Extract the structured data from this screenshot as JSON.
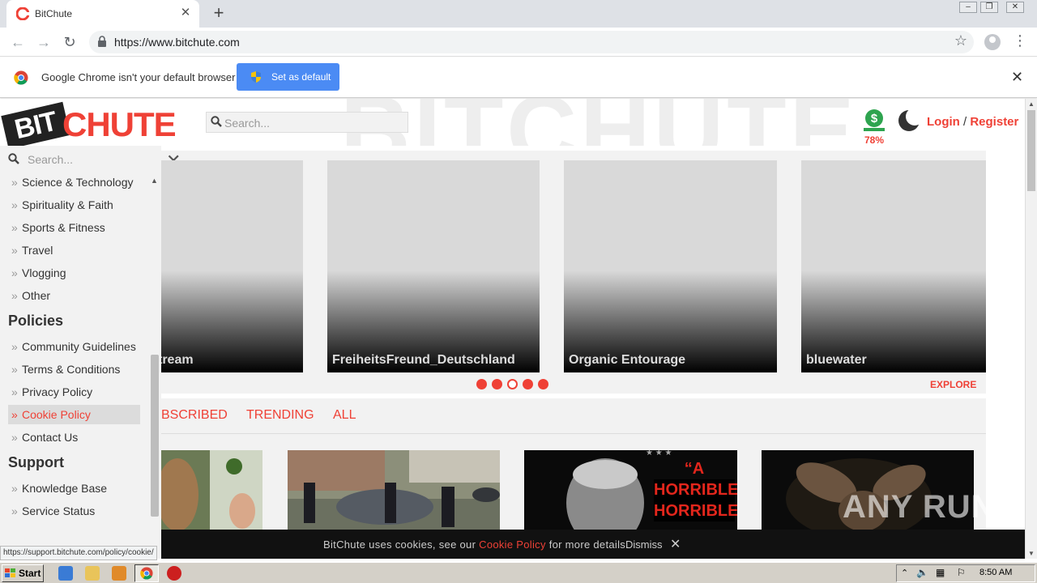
{
  "browser": {
    "tab_title": "BitChute",
    "url": "https://www.bitchute.com",
    "infobar_message": "Google Chrome isn't your default browser",
    "set_default_label": "Set as default"
  },
  "site": {
    "search_placeholder": "Search...",
    "money_percent": "78%",
    "login_label": "Login",
    "separator": "/",
    "register_label": "Register",
    "sidebar": {
      "search_placeholder": "Search...",
      "categories": [
        "Science & Technology",
        "Spirituality & Faith",
        "Sports & Fitness",
        "Travel",
        "Vlogging",
        "Other"
      ],
      "policies_heading": "Policies",
      "policies": [
        "Community Guidelines",
        "Terms & Conditions",
        "Privacy Policy",
        "Cookie Policy",
        "Contact Us"
      ],
      "support_heading": "Support",
      "support": [
        "Knowledge Base",
        "Service Status"
      ]
    },
    "carousel": {
      "channels": [
        "tream",
        "FreiheitsFreund_Deutschland",
        "Organic Entourage",
        "bluewater"
      ],
      "explore_label": "EXPLORE"
    },
    "feed_tabs": [
      "BSCRIBED",
      "TRENDING",
      "ALL"
    ],
    "thumbnail_overlay_text": [
      "“A",
      "HORRIBLE",
      "HORRIBLE"
    ],
    "cookie_bar": {
      "text_before": "BitChute uses cookies, see our ",
      "link": "Cookie Policy",
      "text_after": " for more details.",
      "dismiss": "Dismiss"
    }
  },
  "status_url": "https://support.bitchute.com/policy/cookie/",
  "watermark": "ANY RUN",
  "taskbar": {
    "start_label": "Start",
    "clock": "8:50 AM"
  },
  "colors": {
    "brand_red": "#ef4136",
    "chrome_blue": "#4b8bf4",
    "sidebar_bg": "#f2f2f2"
  }
}
